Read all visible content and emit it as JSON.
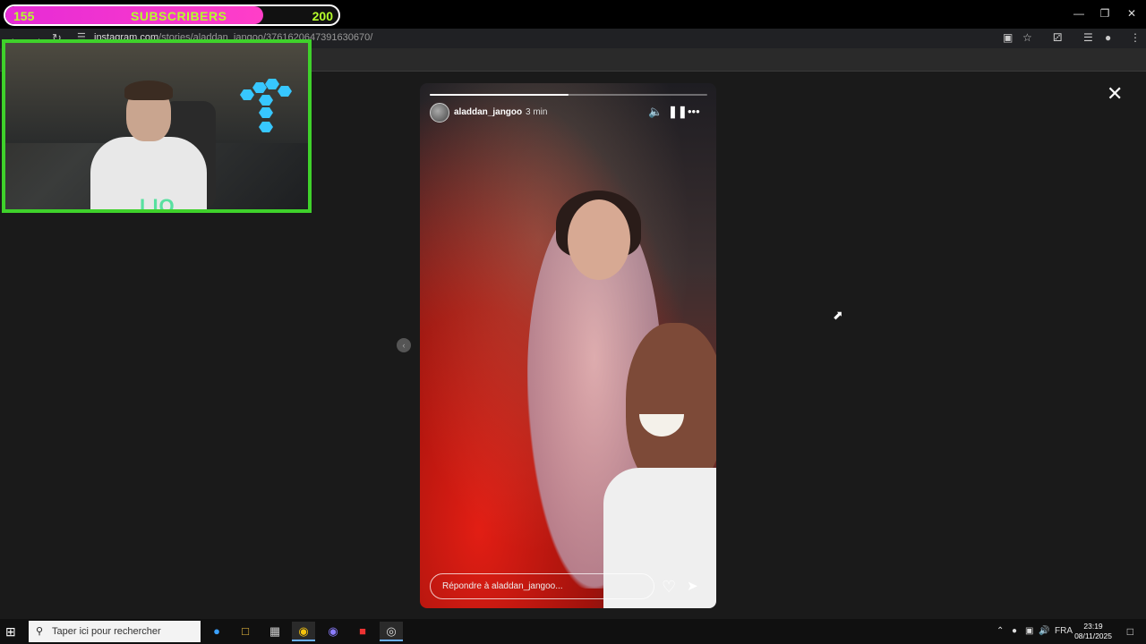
{
  "overlay": {
    "subscribers_current": "155",
    "subscribers_label": "SUBSCRIBERS",
    "subscribers_goal": "200",
    "progress_fraction": 0.775,
    "webcam_logo_text": "LIO"
  },
  "browser": {
    "url_host": "instagram.com",
    "url_path": "/stories/aladdan_jangoo/3761620647391630670/"
  },
  "story": {
    "username": "aladdan_jangoo",
    "time_ago": "3 min",
    "progress_fraction": 0.5,
    "reply_placeholder": "Répondre à aladdan_jangoo..."
  },
  "taskbar": {
    "search_placeholder": "Taper ici pour rechercher",
    "language": "FRA",
    "time": "23:19",
    "date": "08/11/2025"
  },
  "colors": {
    "subbar_fill": "#ff3ec8",
    "subbar_text": "#b6ff2b",
    "webcam_border": "#3fd12b"
  }
}
